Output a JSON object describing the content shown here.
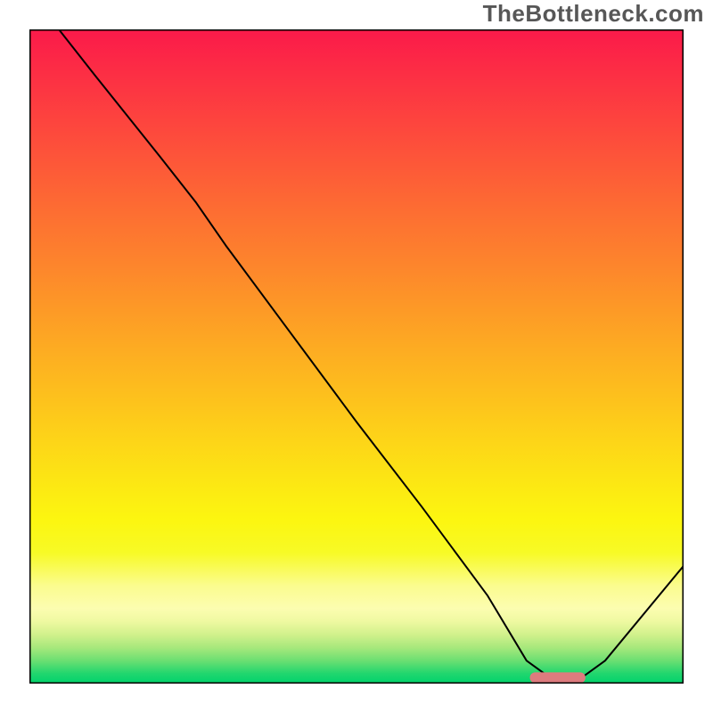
{
  "watermark": "TheBottleneck.com",
  "chart_data": {
    "type": "line",
    "title": "",
    "xlabel": "",
    "ylabel": "",
    "x_range": [
      0,
      100
    ],
    "y_range": [
      0,
      100
    ],
    "series": [
      {
        "name": "curve",
        "x": [
          4.5,
          10,
          20,
          25.5,
          30,
          40,
          50,
          60,
          70,
          76,
          80,
          84,
          88,
          100
        ],
        "y": [
          100,
          93,
          80.5,
          73.5,
          67,
          53.5,
          40,
          27,
          13.5,
          3.5,
          0.6,
          0.6,
          3.5,
          18
        ]
      }
    ],
    "marker": {
      "name": "optimal-range",
      "x_start": 76.5,
      "x_end": 85,
      "y": 0.9,
      "color": "#dd7b7e"
    },
    "gradient_stops": [
      {
        "offset": 0.0,
        "color": "#fb1a4a"
      },
      {
        "offset": 0.07,
        "color": "#fc2f44"
      },
      {
        "offset": 0.14,
        "color": "#fd443e"
      },
      {
        "offset": 0.21,
        "color": "#fd5938"
      },
      {
        "offset": 0.28,
        "color": "#fd6e32"
      },
      {
        "offset": 0.35,
        "color": "#fd822d"
      },
      {
        "offset": 0.42,
        "color": "#fd9727"
      },
      {
        "offset": 0.49,
        "color": "#fdac22"
      },
      {
        "offset": 0.56,
        "color": "#fdc01d"
      },
      {
        "offset": 0.63,
        "color": "#fdd518"
      },
      {
        "offset": 0.7,
        "color": "#fce913"
      },
      {
        "offset": 0.75,
        "color": "#fcf610"
      },
      {
        "offset": 0.8,
        "color": "#f7fa26"
      },
      {
        "offset": 0.85,
        "color": "#fbfc8e"
      },
      {
        "offset": 0.885,
        "color": "#fcfdb0"
      },
      {
        "offset": 0.905,
        "color": "#eff9a1"
      },
      {
        "offset": 0.925,
        "color": "#d1f18c"
      },
      {
        "offset": 0.945,
        "color": "#a7e87c"
      },
      {
        "offset": 0.965,
        "color": "#6bdf72"
      },
      {
        "offset": 0.985,
        "color": "#20d66e"
      },
      {
        "offset": 1.0,
        "color": "#00d26c"
      }
    ],
    "frame_color": "#000000",
    "curve_color": "#000000",
    "curve_width": 2
  }
}
